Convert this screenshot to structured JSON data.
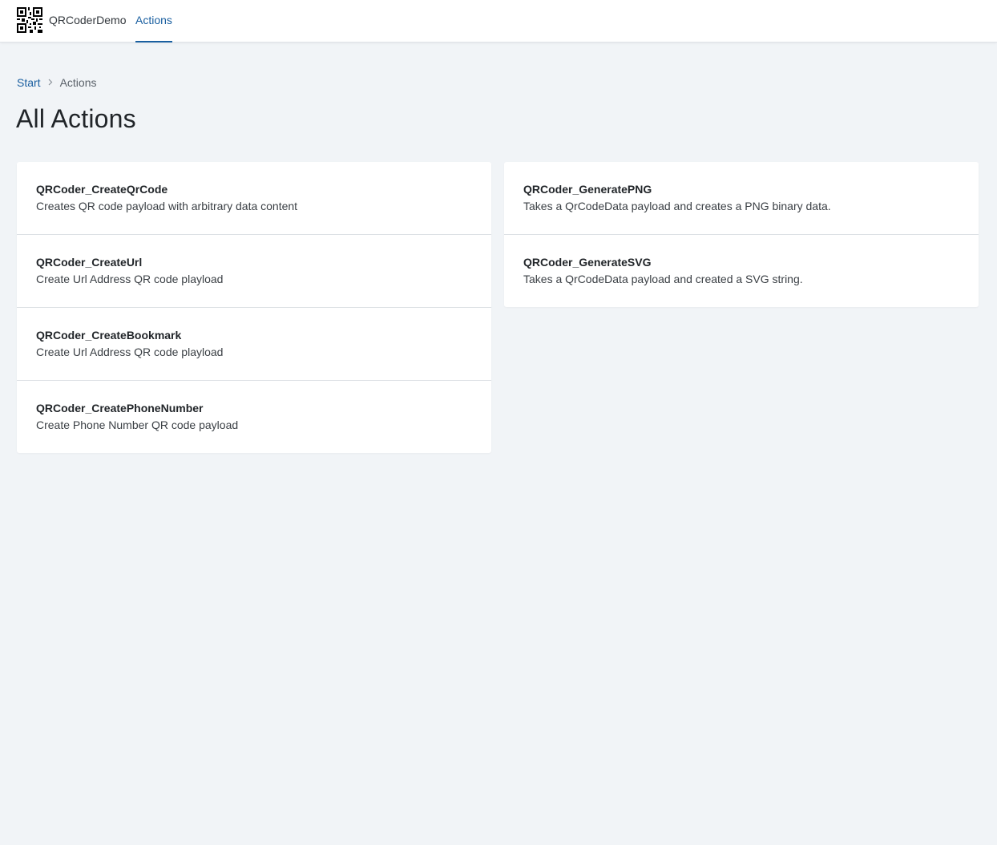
{
  "header": {
    "logo_icon": "qr-code-icon",
    "app_name": "QRCoderDemo",
    "tabs": [
      {
        "label": "Actions",
        "active": true
      }
    ],
    "accent_color": "#1a5fa0"
  },
  "breadcrumb": {
    "items": [
      {
        "label": "Start"
      },
      {
        "label": "Actions"
      }
    ],
    "separator_icon": "chevron-right-icon"
  },
  "page": {
    "title": "All Actions"
  },
  "actions": {
    "left": [
      {
        "title": "QRCoder_CreateQrCode",
        "description": "Creates QR code payload with arbitrary data content"
      },
      {
        "title": "QRCoder_CreateUrl",
        "description": "Create Url Address QR code playload"
      },
      {
        "title": "QRCoder_CreateBookmark",
        "description": "Create Url Address QR code playload"
      },
      {
        "title": "QRCoder_CreatePhoneNumber",
        "description": "Create Phone Number QR code payload"
      }
    ],
    "right": [
      {
        "title": "QRCoder_GeneratePNG",
        "description": "Takes a QrCodeData payload and creates a PNG binary data."
      },
      {
        "title": "QRCoder_GenerateSVG",
        "description": "Takes a QrCodeData payload and created a SVG string."
      }
    ]
  }
}
